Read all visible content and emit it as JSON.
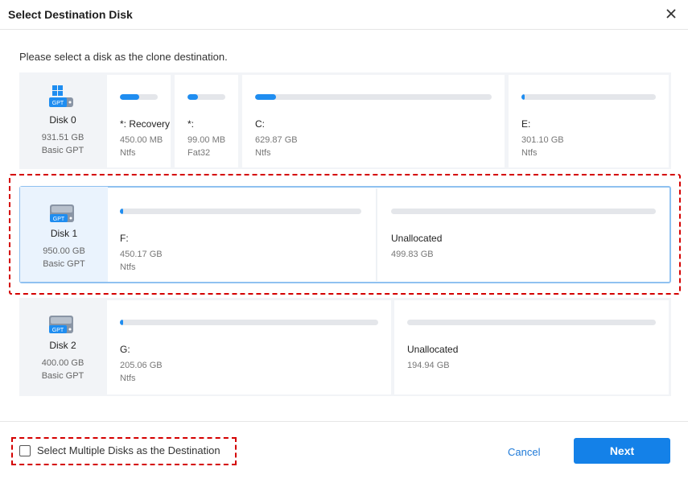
{
  "dialog": {
    "title": "Select Destination Disk",
    "instruction": "Please select a disk as the clone destination."
  },
  "disks": [
    {
      "name": "Disk 0",
      "size": "931.51 GB",
      "type": "Basic GPT",
      "icon": "windows-gpt-disk-icon",
      "selected": false,
      "partitions": [
        {
          "label": "*: Recovery",
          "size": "450.00 MB",
          "fs": "Ntfs",
          "used_fraction": 0.5
        },
        {
          "label": "*:",
          "size": "99.00 MB",
          "fs": "Fat32",
          "used_fraction": 0.28
        },
        {
          "label": "C:",
          "size": "629.87 GB",
          "fs": "Ntfs",
          "used_fraction": 0.09
        },
        {
          "label": "E:",
          "size": "301.10 GB",
          "fs": "Ntfs",
          "used_fraction": 0.02
        }
      ]
    },
    {
      "name": "Disk 1",
      "size": "950.00 GB",
      "type": "Basic GPT",
      "icon": "gpt-disk-icon",
      "selected": true,
      "partitions": [
        {
          "label": "F:",
          "size": "450.17 GB",
          "fs": "Ntfs",
          "used_fraction": 0.01
        },
        {
          "label": "Unallocated",
          "size": "499.83 GB",
          "fs": "",
          "used_fraction": 0
        }
      ]
    },
    {
      "name": "Disk 2",
      "size": "400.00 GB",
      "type": "Basic GPT",
      "icon": "gpt-disk-icon",
      "selected": false,
      "partitions": [
        {
          "label": "G:",
          "size": "205.06 GB",
          "fs": "Ntfs",
          "used_fraction": 0.01
        },
        {
          "label": "Unallocated",
          "size": "194.94 GB",
          "fs": "",
          "used_fraction": 0
        }
      ]
    }
  ],
  "footer": {
    "multi_select_label": "Select Multiple Disks as the Destination",
    "multi_select_checked": false,
    "cancel_label": "Cancel",
    "next_label": "Next"
  },
  "colors": {
    "accent": "#1481e8",
    "bar_fill": "#1f8df0",
    "selected_border": "#8fc1f0",
    "highlight": "#d40000"
  }
}
